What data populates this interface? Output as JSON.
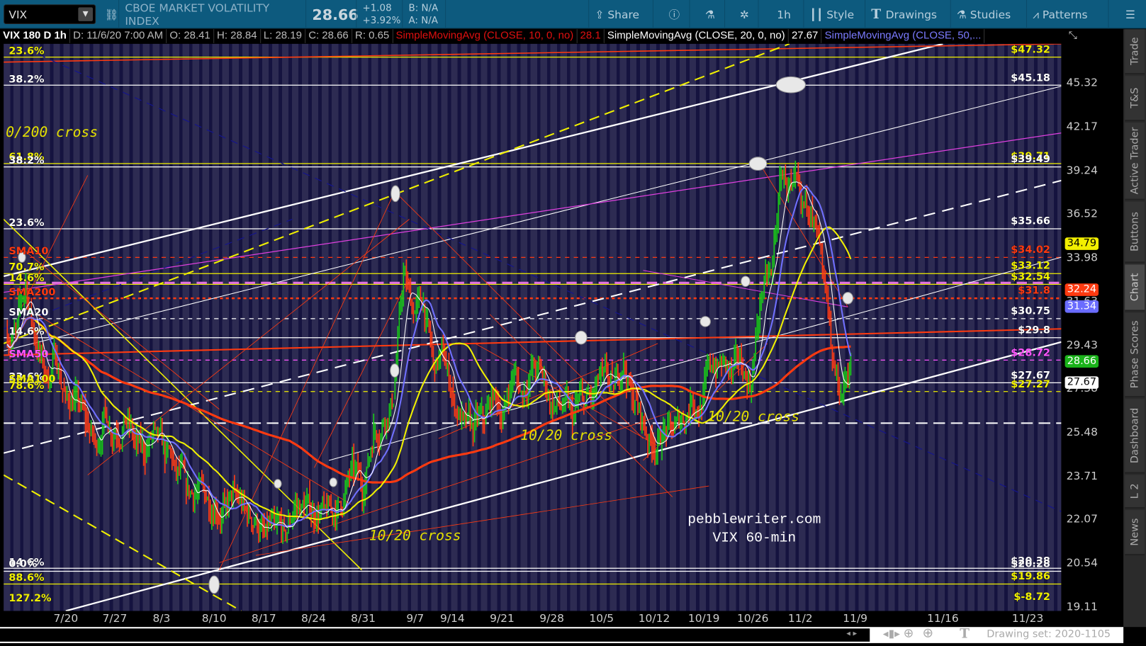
{
  "toolbar": {
    "symbol": "VIX",
    "description": "CBOE MARKET VOLATILITY INDEX",
    "last": "28.66",
    "change": "+1.08",
    "change_pct": "+3.92%",
    "bid": "B: N/A",
    "ask": "A: N/A",
    "share": "Share",
    "timeframe": "1h",
    "style": "Style",
    "drawings": "Drawings",
    "studies": "Studies",
    "patterns": "Patterns"
  },
  "infoline": {
    "title": "VIX 180 D 1h",
    "date": "D: 11/6/20 7:00 AM",
    "open": "O: 28.41",
    "high": "H: 28.84",
    "low": "L: 28.19",
    "close": "C: 28.66",
    "range": "R: 0.65",
    "sma10_label": "SimpleMovingAvg (CLOSE, 10, 0, no)",
    "sma10_value": "28.1",
    "sma20_label": "SimpleMovingAvg (CLOSE, 20, 0, no)",
    "sma20_value": "27.67",
    "sma50_label": "SimpleMovingAvg (CLOSE, 50,..."
  },
  "colors": {
    "up": "#19c819",
    "down": "#ff3b14",
    "sma10": "#ffffff",
    "sma20": "#7070ff",
    "sma50": "#f0f000",
    "sma200": "#ff3a10"
  },
  "price_axis": [
    "45.32",
    "42.17",
    "39.24",
    "36.52",
    "33.98",
    "31.63",
    "29.43",
    "27.38",
    "25.48",
    "23.71",
    "22.07",
    "20.54",
    "19.11"
  ],
  "badges": [
    {
      "text": "34.79",
      "price": 34.79,
      "bg": "#f2ef00",
      "fg": "#000"
    },
    {
      "text": "32.24",
      "price": 32.24,
      "bg": "#ff3a10",
      "fg": "#fff"
    },
    {
      "text": "31.34",
      "price": 31.34,
      "bg": "#6a6cff",
      "fg": "#fff"
    },
    {
      "text": "28.66",
      "price": 28.66,
      "bg": "#1ab31a",
      "fg": "#fff"
    },
    {
      "text": "27.67",
      "price": 27.67,
      "bg": "#fff",
      "fg": "#000"
    }
  ],
  "date_axis": [
    "7/20",
    "7/27",
    "8/3",
    "8/10",
    "8/17",
    "8/24",
    "8/31",
    "9/7",
    "9/14",
    "9/21",
    "9/28",
    "10/5",
    "10/12",
    "10/19",
    "10/26",
    "11/2",
    "11/9",
    "11/16",
    "11/23"
  ],
  "levels": [
    {
      "right": "$47.32",
      "price": 47.32,
      "color": "#f0f000",
      "style": "solid"
    },
    {
      "right": "$45.18",
      "price": 45.18,
      "color": "#ffffff",
      "style": "solid"
    },
    {
      "right": "$39.71",
      "price": 39.71,
      "color": "#f0f000",
      "style": "solid"
    },
    {
      "right": "$39.49",
      "price": 39.49,
      "color": "#ffffff",
      "style": "solid"
    },
    {
      "right": "$35.66",
      "price": 35.66,
      "color": "#ffffff",
      "style": "solid"
    },
    {
      "right": "$34.02",
      "price": 34.02,
      "color": "#ff3a10",
      "style": "dash"
    },
    {
      "right": "$33.12",
      "price": 33.12,
      "color": "#f0f000",
      "style": "solid"
    },
    {
      "right": "$32.54",
      "price": 32.54,
      "color": "#f0f000",
      "style": "solid"
    },
    {
      "right": "$31.8",
      "price": 31.8,
      "color": "#ff3a10",
      "style": "dot"
    },
    {
      "right": "$30.75",
      "price": 30.75,
      "color": "#ffffff",
      "style": "dash"
    },
    {
      "right": "$29.8",
      "price": 29.8,
      "color": "#ffffff",
      "style": "solid"
    },
    {
      "right": "$28.72",
      "price": 28.72,
      "color": "#ff55ff",
      "style": "dash"
    },
    {
      "right": "$27.67",
      "price": 27.67,
      "color": "#ffffff",
      "style": "solid"
    },
    {
      "right": "$27.27",
      "price": 27.27,
      "color": "#f0f000",
      "style": "dash"
    },
    {
      "right": "$20.38",
      "price": 20.38,
      "color": "#ffffff",
      "style": "solid"
    },
    {
      "right": "$20.28",
      "price": 20.28,
      "color": "#ffffff",
      "style": "solid"
    },
    {
      "right": "$19.86",
      "price": 19.86,
      "color": "#f0f000",
      "style": "solid"
    },
    {
      "right": "$-8.72",
      "price": 19.2,
      "color": "#f0f000",
      "style": "none"
    }
  ],
  "left_labels": [
    {
      "text": "23.6%",
      "price": 47.32,
      "color": "#f0f000"
    },
    {
      "text": "38.2%",
      "price": 45.18,
      "color": "#ffffff"
    },
    {
      "text": "61.8%",
      "price": 39.75,
      "color": "#f0f000"
    },
    {
      "text": "38.2%",
      "price": 39.49,
      "color": "#ffffff"
    },
    {
      "text": "23.6%",
      "price": 35.66,
      "color": "#ffffff"
    },
    {
      "text": "SMA10",
      "price": 34.02,
      "color": "#ff3a10"
    },
    {
      "text": "70.7%",
      "price": 33.12,
      "color": "#f0f000"
    },
    {
      "text": "14.6%",
      "price": 32.54,
      "color": "#f0f000"
    },
    {
      "text": "SMA200",
      "price": 31.8,
      "color": "#ff3a10"
    },
    {
      "text": "SMA20",
      "price": 30.75,
      "color": "#ffffff"
    },
    {
      "text": "14.6%",
      "price": 29.8,
      "color": "#ffffff"
    },
    {
      "text": "SMA50",
      "price": 28.72,
      "color": "#ff55ff"
    },
    {
      "text": "23.6%",
      "price": 27.67,
      "color": "#ffffff"
    },
    {
      "text": "SMA100",
      "price": 27.55,
      "color": "#f0f000"
    },
    {
      "text": "78.6%",
      "price": 27.27,
      "color": "#f0f000"
    },
    {
      "text": "14.6%",
      "price": 20.38,
      "color": "#ffffff"
    },
    {
      "text": "0.0%",
      "price": 20.33,
      "color": "#ffffff"
    },
    {
      "text": "88.6%",
      "price": 19.86,
      "color": "#f0f000"
    },
    {
      "text": "127.2%",
      "price": 19.2,
      "color": "#f0f000"
    }
  ],
  "annotations": {
    "cross_1": "0/200 cross",
    "cross_2": "10/20 cross",
    "cross_3": "10/20 cross",
    "cross_4": "10/20 cross",
    "site": "pebblewriter.com",
    "caption": "VIX 60-min"
  },
  "sidebar": [
    "Trade",
    "T&S",
    "Active Trader",
    "Buttons",
    "Chart",
    "Phase Scores",
    "Dashboard",
    "L 2",
    "News"
  ],
  "bottom": {
    "drawing_set": "Drawing set: 2020-1105"
  },
  "chart_data": {
    "type": "candlestick",
    "title": "VIX 180 D 1h",
    "scale": "log",
    "ylim": [
      19.11,
      47.5
    ],
    "daily_closes": [
      [
        "7/10",
        30
      ],
      [
        "7/13",
        32.5
      ],
      [
        "7/14",
        29.5
      ],
      [
        "7/15",
        28
      ],
      [
        "7/16",
        29
      ],
      [
        "7/17",
        27
      ],
      [
        "7/20",
        27
      ],
      [
        "7/21",
        26
      ],
      [
        "7/22",
        25
      ],
      [
        "7/23",
        26.5
      ],
      [
        "7/24",
        25.5
      ],
      [
        "7/27",
        26
      ],
      [
        "7/28",
        25
      ],
      [
        "7/29",
        24.5
      ],
      [
        "7/30",
        25.5
      ],
      [
        "7/31",
        24.5
      ],
      [
        "8/3",
        24
      ],
      [
        "8/4",
        23.5
      ],
      [
        "8/5",
        23
      ],
      [
        "8/6",
        23
      ],
      [
        "8/7",
        22.5
      ],
      [
        "8/10",
        22.5
      ],
      [
        "8/11",
        23
      ],
      [
        "8/12",
        22.5
      ],
      [
        "8/13",
        22
      ],
      [
        "8/14",
        21.5
      ],
      [
        "8/17",
        21.8
      ],
      [
        "8/18",
        21.6
      ],
      [
        "8/19",
        22.5
      ],
      [
        "8/20",
        22.5
      ],
      [
        "8/21",
        22.2
      ],
      [
        "8/24",
        22.5
      ],
      [
        "8/25",
        22.3
      ],
      [
        "8/26",
        22.8
      ],
      [
        "8/27",
        24
      ],
      [
        "8/28",
        23
      ],
      [
        "8/31",
        25.5
      ],
      [
        "9/1",
        26
      ],
      [
        "9/2",
        27
      ],
      [
        "9/3",
        33
      ],
      [
        "9/4",
        31
      ],
      [
        "9/8",
        31.5
      ],
      [
        "9/9",
        28.5
      ],
      [
        "9/10",
        29
      ],
      [
        "9/11",
        27
      ],
      [
        "9/14",
        26
      ],
      [
        "9/15",
        25.5
      ],
      [
        "9/16",
        26
      ],
      [
        "9/17",
        27
      ],
      [
        "9/18",
        26
      ],
      [
        "9/21",
        28
      ],
      [
        "9/22",
        27
      ],
      [
        "9/23",
        28.5
      ],
      [
        "9/24",
        28
      ],
      [
        "9/25",
        26.5
      ],
      [
        "9/28",
        26.5
      ],
      [
        "9/29",
        26
      ],
      [
        "9/30",
        27
      ],
      [
        "10/1",
        27
      ],
      [
        "10/2",
        28
      ],
      [
        "10/5",
        27.5
      ],
      [
        "10/6",
        28.5
      ],
      [
        "10/7",
        27
      ],
      [
        "10/8",
        26
      ],
      [
        "10/9",
        25
      ],
      [
        "10/12",
        25.2
      ],
      [
        "10/13",
        25.5
      ],
      [
        "10/14",
        26
      ],
      [
        "10/15",
        27
      ],
      [
        "10/16",
        26.5
      ],
      [
        "10/19",
        28.5
      ],
      [
        "10/20",
        28.5
      ],
      [
        "10/21",
        28
      ],
      [
        "10/22",
        28.5
      ],
      [
        "10/23",
        27.5
      ],
      [
        "10/26",
        32
      ],
      [
        "10/27",
        33
      ],
      [
        "10/28",
        39
      ],
      [
        "10/29",
        38
      ],
      [
        "10/30",
        37
      ],
      [
        "11/2",
        37
      ],
      [
        "11/3",
        34
      ],
      [
        "11/4",
        29
      ],
      [
        "11/5",
        27
      ],
      [
        "11/6",
        28.66
      ]
    ],
    "moving_averages": [
      {
        "name": "SMA10",
        "last": 28.1
      },
      {
        "name": "SMA20",
        "last": 27.67
      },
      {
        "name": "SMA50",
        "last": 31.34
      },
      {
        "name": "SMA200",
        "last": 32.24
      }
    ]
  }
}
